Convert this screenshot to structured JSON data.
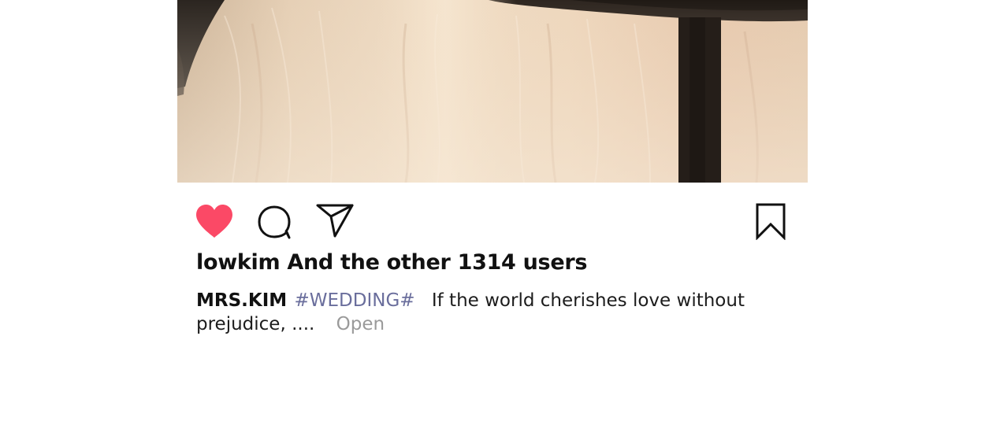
{
  "post": {
    "photo": {
      "icon": "wedding-dress-photo"
    },
    "actions": {
      "like_icon": "heart-filled-icon",
      "like_color": "#fb4966",
      "comment_icon": "speech-bubble-icon",
      "share_icon": "paper-plane-icon",
      "save_icon": "bookmark-icon"
    },
    "likes_text": "lowkim And the other 1314 users",
    "caption": {
      "author": "MRS.KIM",
      "hashtag": "#WEDDING#",
      "text": "If the world cherishes love without prejudice, ....",
      "open_label": "Open",
      "hashtag_color": "#6a6e9c",
      "open_color": "#9a9a9a"
    }
  }
}
